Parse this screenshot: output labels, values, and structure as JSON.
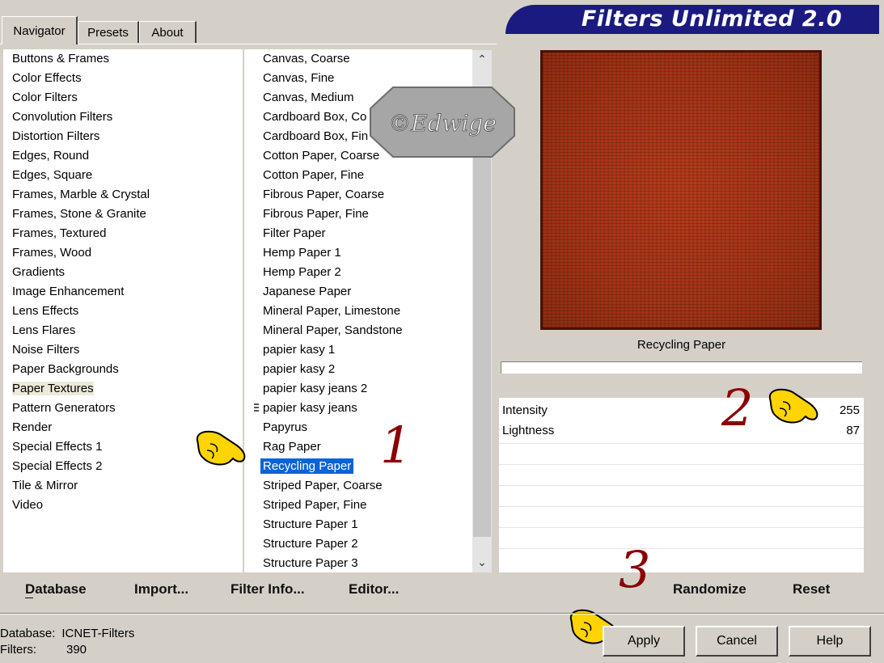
{
  "tabs": [
    "Navigator",
    "Presets",
    "About"
  ],
  "banner_title": "Filters Unlimited 2.0",
  "categories": [
    "Buttons & Frames",
    "Color Effects",
    "Color Filters",
    "Convolution Filters",
    "Distortion Filters",
    "Edges, Round",
    "Edges, Square",
    "Frames, Marble & Crystal",
    "Frames, Stone & Granite",
    "Frames, Textured",
    "Frames, Wood",
    "Gradients",
    "Image Enhancement",
    "Lens Effects",
    "Lens Flares",
    "Noise Filters",
    "Paper Backgrounds",
    "Paper Textures",
    "Pattern Generators",
    "Render",
    "Special Effects 1",
    "Special Effects 2",
    "Tile & Mirror",
    "Video"
  ],
  "selected_category": "Paper Textures",
  "filters": [
    "Canvas, Coarse",
    "Canvas, Fine",
    "Canvas, Medium",
    "Cardboard Box, Co",
    "Cardboard Box, Fin",
    "Cotton Paper, Coarse",
    "Cotton Paper, Fine",
    "Fibrous Paper, Coarse",
    "Fibrous Paper, Fine",
    "Filter Paper",
    "Hemp Paper 1",
    "Hemp Paper 2",
    "Japanese Paper",
    "Mineral Paper, Limestone",
    "Mineral Paper, Sandstone",
    "papier kasy 1",
    "papier kasy 2",
    "papier kasy jeans 2",
    "papier kasy jeans",
    "Papyrus",
    "Rag Paper",
    "Recycling Paper",
    "Striped Paper, Coarse",
    "Striped Paper, Fine",
    "Structure Paper 1",
    "Structure Paper 2",
    "Structure Paper 3"
  ],
  "selected_filter": "Recycling Paper",
  "preview_label": "Recycling Paper",
  "params": [
    {
      "name": "Intensity",
      "value": "255"
    },
    {
      "name": "Lightness",
      "value": "87"
    }
  ],
  "watermark": "©Edwige",
  "annotations": {
    "step1": "1",
    "step2": "2",
    "step3": "3"
  },
  "toolbar": {
    "database": "Database",
    "import": "Import...",
    "filter_info": "Filter Info...",
    "editor": "Editor...",
    "randomize": "Randomize",
    "reset": "Reset"
  },
  "status": {
    "db_label": "Database:",
    "db_value": "ICNET-Filters",
    "filters_label": "Filters:",
    "filters_value": "390"
  },
  "buttons": {
    "apply": "Apply",
    "cancel": "Cancel",
    "help": "Help"
  },
  "colors": {
    "banner": "#1a1a80",
    "selection": "#0a64d8",
    "annotation": "#8b0000"
  }
}
